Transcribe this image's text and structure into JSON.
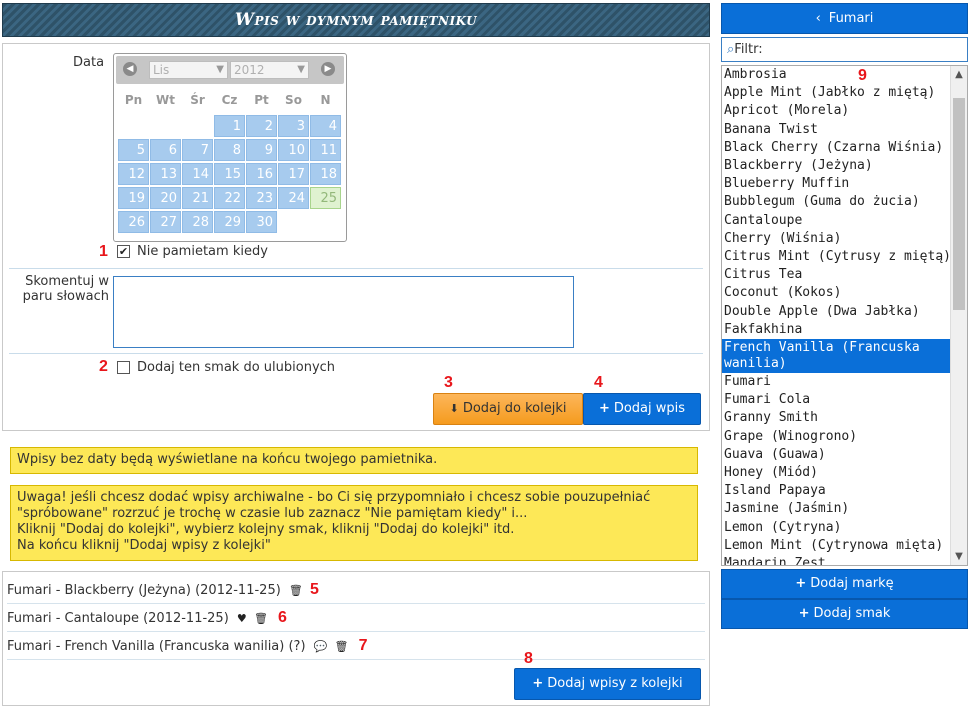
{
  "header": {
    "title": "Wpis w dymnym pamiętniku"
  },
  "form": {
    "date_label": "Data",
    "calendar": {
      "month": "Lis",
      "year": "2012",
      "weekdays": [
        "Pn",
        "Wt",
        "Śr",
        "Cz",
        "Pt",
        "So",
        "N"
      ],
      "days": [
        "",
        "",
        "",
        "1",
        "2",
        "3",
        "4",
        "5",
        "6",
        "7",
        "8",
        "9",
        "10",
        "11",
        "12",
        "13",
        "14",
        "15",
        "16",
        "17",
        "18",
        "19",
        "20",
        "21",
        "22",
        "23",
        "24",
        "25",
        "26",
        "27",
        "28",
        "29",
        "30"
      ],
      "today": "25"
    },
    "nie_pamietam": {
      "number": "1",
      "label": "Nie pamietam kiedy",
      "checked": true
    },
    "comment_label_1": "Skomentuj w",
    "comment_label_2": "paru słowach",
    "comment_value": "",
    "favorite": {
      "number": "2",
      "label": "Dodaj ten smak do ulubionych",
      "checked": false
    },
    "queue_button": {
      "number": "3",
      "label": "Dodaj do kolejki"
    },
    "add_button": {
      "number": "4",
      "label": "Dodaj wpis"
    }
  },
  "notices": {
    "first": "Wpisy bez daty będą wyświetlane na końcu twojego pamietnika.",
    "second": [
      "Uwaga! jeśli chcesz dodać wpisy archiwalne - bo Ci się przypomniało i chcesz sobie pouzupełniać",
      "\"spróbowane\" rozrzuć je trochę w czasie lub zaznacz \"Nie pamiętam kiedy\" i...",
      "Kliknij \"Dodaj do kolejki\", wybierz kolejny smak, kliknij \"Dodaj do kolejki\" itd.",
      "Na końcu kliknij \"Dodaj wpisy z kolejki\""
    ]
  },
  "queue": {
    "items": [
      {
        "text": "Fumari - Blackberry (Jeżyna) (2012-11-25)",
        "number": "5"
      },
      {
        "text": "Fumari - Cantaloupe (2012-11-25)",
        "number": "6"
      },
      {
        "text": "Fumari - French Vanilla (Francuska wanilia) (?)",
        "number": "7"
      }
    ],
    "add_all": {
      "number": "8",
      "label": "Dodaj wpisy z kolejki"
    }
  },
  "sidebar": {
    "brand": "Fumari",
    "filter_label": "Filtr:",
    "list_number": "9",
    "flavors": [
      "Ambrosia",
      "Apple Mint (Jabłko z miętą)",
      "Apricot (Morela)",
      "Banana Twist",
      "Black Cherry (Czarna Wiśnia)",
      "Blackberry (Jeżyna)",
      "Blueberry Muffin",
      "Bubblegum (Guma do żucia)",
      "Cantaloupe",
      "Cherry (Wiśnia)",
      "Citrus Mint (Cytrusy z miętą)",
      "Citrus Tea",
      "Coconut (Kokos)",
      "Double Apple (Dwa Jabłka)",
      "Fakfakhina",
      "French Vanilla (Francuska wanilia)",
      "Fumari",
      "Fumari Cola",
      "Granny Smith",
      "Grape (Winogrono)",
      "Guava (Guawa)",
      "Honey (Miód)",
      "Island Papaya",
      "Jasmine (Jaśmin)",
      "Lemon (Cytryna)",
      "Lemon Mint (Cytrynowa mięta)",
      "Mandarin Zest"
    ],
    "selected": "French Vanilla (Francuska wanilia)",
    "add_brand": "Dodaj markę",
    "add_flavor": "Dodaj smak"
  }
}
